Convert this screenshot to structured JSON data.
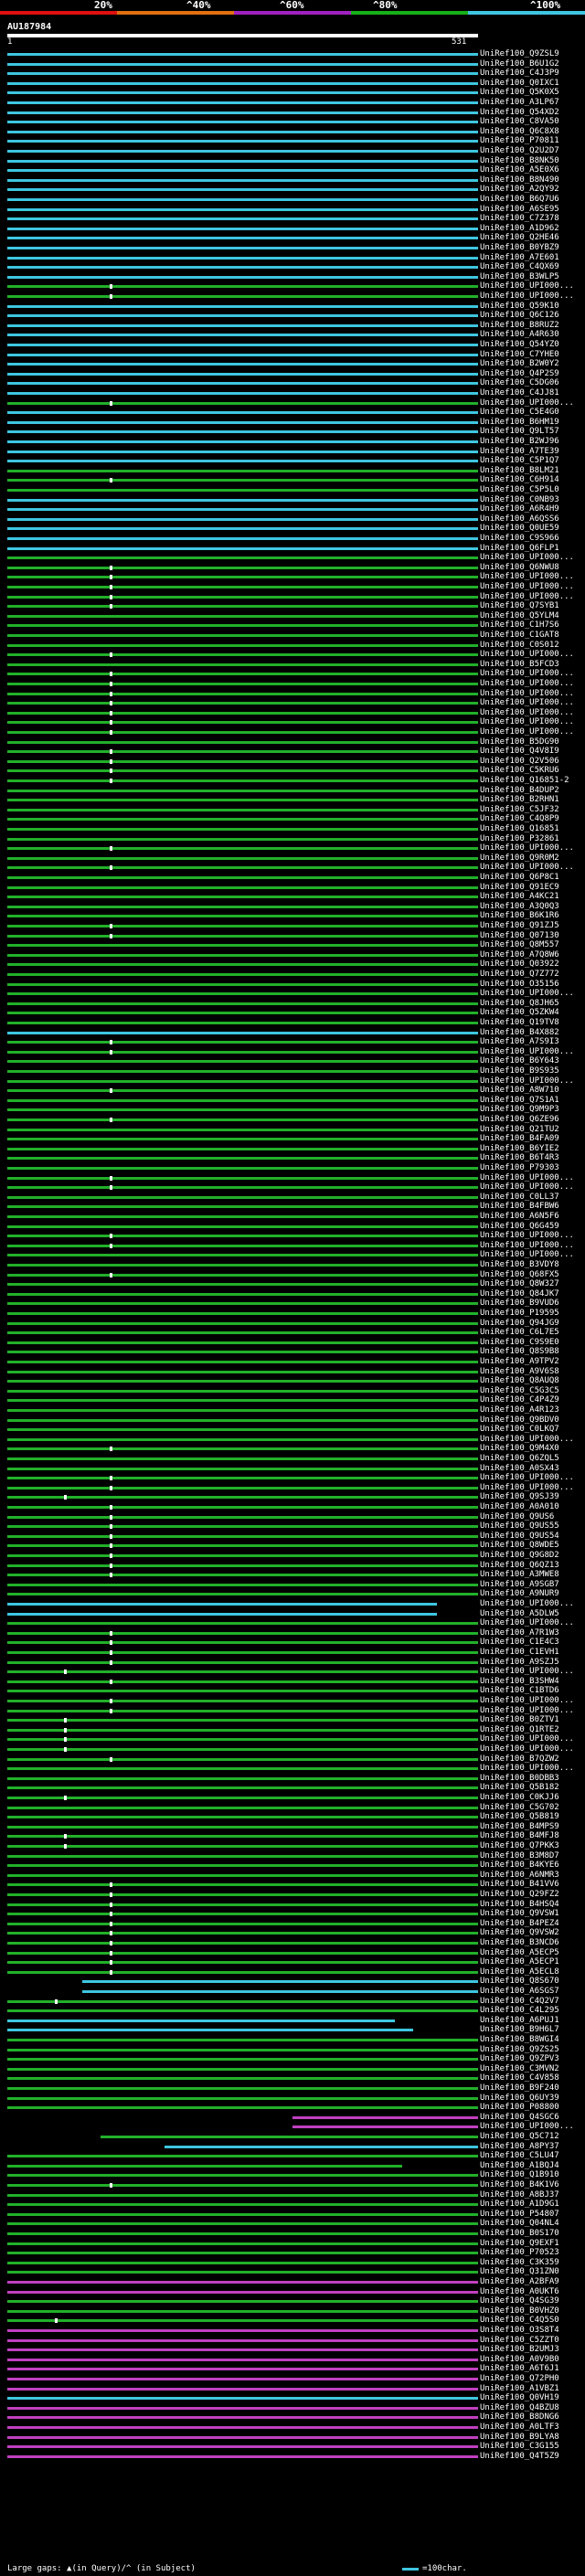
{
  "legend": {
    "ticks": [
      "20%",
      "^40%",
      "^60%",
      "^80%",
      "^100%"
    ],
    "colors": [
      "#e01010",
      "#e07010",
      "#a020c0",
      "#18b018",
      "#3ec6e0"
    ]
  },
  "query": {
    "name": "AU187984",
    "start": "1",
    "end": "531"
  },
  "hits": [
    {
      "label": "UniRef100_Q9ZSL9",
      "color": "cyan"
    },
    {
      "label": "UniRef100_B6U1G2",
      "color": "cyan"
    },
    {
      "label": "UniRef100_C4J3P9",
      "color": "cyan"
    },
    {
      "label": "UniRef100_Q0IXC1",
      "color": "cyan"
    },
    {
      "label": "UniRef100_Q5K0X5",
      "color": "cyan"
    },
    {
      "label": "UniRef100_A3LP67",
      "color": "cyan"
    },
    {
      "label": "UniRef100_Q54XD2",
      "color": "cyan"
    },
    {
      "label": "UniRef100_C8VA50",
      "color": "cyan"
    },
    {
      "label": "UniRef100_Q6C8X8",
      "color": "cyan"
    },
    {
      "label": "UniRef100_P70811",
      "color": "cyan"
    },
    {
      "label": "UniRef100_Q2U2D7",
      "color": "cyan"
    },
    {
      "label": "UniRef100_B8NK50",
      "color": "cyan"
    },
    {
      "label": "UniRef100_A5E0X6",
      "color": "cyan"
    },
    {
      "label": "UniRef100_B8N490",
      "color": "cyan"
    },
    {
      "label": "UniRef100_A2QY92",
      "color": "cyan"
    },
    {
      "label": "UniRef100_B6Q7U6",
      "color": "cyan"
    },
    {
      "label": "UniRef100_A6SE95",
      "color": "cyan"
    },
    {
      "label": "UniRef100_C7Z378",
      "color": "cyan"
    },
    {
      "label": "UniRef100_A1D962",
      "color": "cyan"
    },
    {
      "label": "UniRef100_Q2HE46",
      "color": "cyan"
    },
    {
      "label": "UniRef100_B0YBZ9",
      "color": "cyan"
    },
    {
      "label": "UniRef100_A7E601",
      "color": "cyan"
    },
    {
      "label": "UniRef100_C4QX69",
      "color": "cyan"
    },
    {
      "label": "UniRef100_B3WLP5",
      "color": "cyan"
    },
    {
      "label": "UniRef100_UPI000...",
      "color": "green",
      "dot": 120
    },
    {
      "label": "UniRef100_UPI000...",
      "color": "green",
      "dot": 120
    },
    {
      "label": "UniRef100_Q59K10",
      "color": "cyan"
    },
    {
      "label": "UniRef100_Q6C126",
      "color": "cyan"
    },
    {
      "label": "UniRef100_B8RUZ2",
      "color": "cyan"
    },
    {
      "label": "UniRef100_A4R630",
      "color": "cyan"
    },
    {
      "label": "UniRef100_Q54YZ0",
      "color": "cyan"
    },
    {
      "label": "UniRef100_C7YHE0",
      "color": "cyan"
    },
    {
      "label": "UniRef100_B2W0Y2",
      "color": "cyan"
    },
    {
      "label": "UniRef100_Q4P2S9",
      "color": "cyan"
    },
    {
      "label": "UniRef100_C5DG06",
      "color": "cyan"
    },
    {
      "label": "UniRef100_C4JJ81",
      "color": "cyan"
    },
    {
      "label": "UniRef100_UPI000...",
      "color": "green",
      "dot": 120
    },
    {
      "label": "UniRef100_C5E4G0",
      "color": "cyan"
    },
    {
      "label": "UniRef100_B6HM19",
      "color": "cyan"
    },
    {
      "label": "UniRef100_Q9LT57",
      "color": "cyan"
    },
    {
      "label": "UniRef100_B2WJ96",
      "color": "cyan"
    },
    {
      "label": "UniRef100_A7TE39",
      "color": "cyan"
    },
    {
      "label": "UniRef100_C5P1Q7",
      "color": "cyan"
    },
    {
      "label": "UniRef100_B8LM21",
      "color": "green"
    },
    {
      "label": "UniRef100_C6H914",
      "color": "green",
      "dot": 120
    },
    {
      "label": "UniRef100_C5P5L0",
      "color": "green"
    },
    {
      "label": "UniRef100_C0NB93",
      "color": "cyan"
    },
    {
      "label": "UniRef100_A6R4H9",
      "color": "cyan"
    },
    {
      "label": "UniRef100_A6QSS6",
      "color": "cyan"
    },
    {
      "label": "UniRef100_Q0UE59",
      "color": "cyan"
    },
    {
      "label": "UniRef100_C9S966",
      "color": "cyan"
    },
    {
      "label": "UniRef100_Q6FLP1",
      "color": "cyan"
    },
    {
      "label": "UniRef100_UPI000...",
      "color": "green"
    },
    {
      "label": "UniRef100_Q6NWU8",
      "color": "green",
      "dot": 120
    },
    {
      "label": "UniRef100_UPI000...",
      "color": "green",
      "dot": 120
    },
    {
      "label": "UniRef100_UPI000...",
      "color": "green",
      "dot": 120
    },
    {
      "label": "UniRef100_UPI000...",
      "color": "green",
      "dot": 120
    },
    {
      "label": "UniRef100_Q7SYB1",
      "color": "green",
      "dot": 120
    },
    {
      "label": "UniRef100_Q5YLM4",
      "color": "green"
    },
    {
      "label": "UniRef100_C1H7S6",
      "color": "green"
    },
    {
      "label": "UniRef100_C1GAT8",
      "color": "green"
    },
    {
      "label": "UniRef100_C0S012",
      "color": "green"
    },
    {
      "label": "UniRef100_UPI000...",
      "color": "green",
      "dot": 120
    },
    {
      "label": "UniRef100_B5FCD3",
      "color": "green"
    },
    {
      "label": "UniRef100_UPI000...",
      "color": "green",
      "dot": 120
    },
    {
      "label": "UniRef100_UPI000...",
      "color": "green",
      "dot": 120
    },
    {
      "label": "UniRef100_UPI000...",
      "color": "green",
      "dot": 120
    },
    {
      "label": "UniRef100_UPI000...",
      "color": "green",
      "dot": 120
    },
    {
      "label": "UniRef100_UPI000...",
      "color": "green",
      "dot": 120
    },
    {
      "label": "UniRef100_UPI000...",
      "color": "green",
      "dot": 120
    },
    {
      "label": "UniRef100_UPI000...",
      "color": "green",
      "dot": 120
    },
    {
      "label": "UniRef100_B5DG90",
      "color": "green"
    },
    {
      "label": "UniRef100_Q4V8I9",
      "color": "green",
      "dot": 120
    },
    {
      "label": "UniRef100_Q2V506",
      "color": "green",
      "dot": 120
    },
    {
      "label": "UniRef100_C5KRU6",
      "color": "green",
      "dot": 120
    },
    {
      "label": "UniRef100_Q16851-2",
      "color": "green",
      "dot": 120
    },
    {
      "label": "UniRef100_B4DUP2",
      "color": "green"
    },
    {
      "label": "UniRef100_B2RHN1",
      "color": "green"
    },
    {
      "label": "UniRef100_C5JF32",
      "color": "green"
    },
    {
      "label": "UniRef100_C4Q8P9",
      "color": "green"
    },
    {
      "label": "UniRef100_Q16851",
      "color": "green"
    },
    {
      "label": "UniRef100_P32861",
      "color": "green"
    },
    {
      "label": "UniRef100_UPI000...",
      "color": "green",
      "dot": 120
    },
    {
      "label": "UniRef100_Q9R0M2",
      "color": "green"
    },
    {
      "label": "UniRef100_UPI000...",
      "color": "green",
      "dot": 120
    },
    {
      "label": "UniRef100_Q6P8C1",
      "color": "green"
    },
    {
      "label": "UniRef100_Q91EC9",
      "color": "green"
    },
    {
      "label": "UniRef100_A4KC21",
      "color": "green"
    },
    {
      "label": "UniRef100_A3Q0Q3",
      "color": "green"
    },
    {
      "label": "UniRef100_B6K1R6",
      "color": "green"
    },
    {
      "label": "UniRef100_Q91ZJ5",
      "color": "green",
      "dot": 120
    },
    {
      "label": "UniRef100_Q07130",
      "color": "green",
      "dot": 120
    },
    {
      "label": "UniRef100_Q8M557",
      "color": "green"
    },
    {
      "label": "UniRef100_A7Q8W6",
      "color": "green"
    },
    {
      "label": "UniRef100_Q03922",
      "color": "green"
    },
    {
      "label": "UniRef100_Q7Z772",
      "color": "green"
    },
    {
      "label": "UniRef100_O35156",
      "color": "green"
    },
    {
      "label": "UniRef100_UPI000...",
      "color": "green"
    },
    {
      "label": "UniRef100_Q8JH65",
      "color": "green"
    },
    {
      "label": "UniRef100_Q5ZKW4",
      "color": "green"
    },
    {
      "label": "UniRef100_Q19TV8",
      "color": "green"
    },
    {
      "label": "UniRef100_B4X882",
      "color": "cyan"
    },
    {
      "label": "UniRef100_A7S9I3",
      "color": "green",
      "dot": 120
    },
    {
      "label": "UniRef100_UPI000...",
      "color": "green",
      "dot": 120
    },
    {
      "label": "UniRef100_B6Y643",
      "color": "green"
    },
    {
      "label": "UniRef100_B9S935",
      "color": "green"
    },
    {
      "label": "UniRef100_UPI000...",
      "color": "green"
    },
    {
      "label": "UniRef100_A8W710",
      "color": "green",
      "dot": 120
    },
    {
      "label": "UniRef100_Q7S1A1",
      "color": "green"
    },
    {
      "label": "UniRef100_Q9M9P3",
      "color": "green"
    },
    {
      "label": "UniRef100_Q6ZE96",
      "color": "green",
      "dot": 120
    },
    {
      "label": "UniRef100_Q21TU2",
      "color": "green"
    },
    {
      "label": "UniRef100_B4FA09",
      "color": "green"
    },
    {
      "label": "UniRef100_B6YIE2",
      "color": "green"
    },
    {
      "label": "UniRef100_B6T4R3",
      "color": "green"
    },
    {
      "label": "UniRef100_P79303",
      "color": "green"
    },
    {
      "label": "UniRef100_UPI000...",
      "color": "green",
      "dot": 120
    },
    {
      "label": "UniRef100_UPI000...",
      "color": "green",
      "dot": 120
    },
    {
      "label": "UniRef100_C0LL37",
      "color": "green"
    },
    {
      "label": "UniRef100_B4FBW6",
      "color": "green"
    },
    {
      "label": "UniRef100_A6N5F6",
      "color": "green"
    },
    {
      "label": "UniRef100_Q6G459",
      "color": "green"
    },
    {
      "label": "UniRef100_UPI000...",
      "color": "green",
      "dot": 120
    },
    {
      "label": "UniRef100_UPI000...",
      "color": "green",
      "dot": 120
    },
    {
      "label": "UniRef100_UPI000...",
      "color": "green"
    },
    {
      "label": "UniRef100_B3VDY8",
      "color": "green"
    },
    {
      "label": "UniRef100_Q68FX5",
      "color": "green",
      "dot": 120
    },
    {
      "label": "UniRef100_Q8W327",
      "color": "green"
    },
    {
      "label": "UniRef100_Q84JK7",
      "color": "green"
    },
    {
      "label": "UniRef100_B9VUD6",
      "color": "green"
    },
    {
      "label": "UniRef100_P19595",
      "color": "green"
    },
    {
      "label": "UniRef100_Q94JG9",
      "color": "green"
    },
    {
      "label": "UniRef100_C6L7E5",
      "color": "green"
    },
    {
      "label": "UniRef100_C9S9E0",
      "color": "green"
    },
    {
      "label": "UniRef100_Q8S9B8",
      "color": "green"
    },
    {
      "label": "UniRef100_A9TPV2",
      "color": "green"
    },
    {
      "label": "UniRef100_A9V6S8",
      "color": "green"
    },
    {
      "label": "UniRef100_Q8AUQ8",
      "color": "green"
    },
    {
      "label": "UniRef100_C5G3C5",
      "color": "green"
    },
    {
      "label": "UniRef100_C4P4Z9",
      "color": "green"
    },
    {
      "label": "UniRef100_A4R123",
      "color": "green"
    },
    {
      "label": "UniRef100_Q9BDV0",
      "color": "green"
    },
    {
      "label": "UniRef100_C0LKQ7",
      "color": "green"
    },
    {
      "label": "UniRef100_UPI000...",
      "color": "green"
    },
    {
      "label": "UniRef100_Q9M4X0",
      "color": "green",
      "dot": 120
    },
    {
      "label": "UniRef100_Q6ZQL5",
      "color": "green"
    },
    {
      "label": "UniRef100_A0SX43",
      "color": "green"
    },
    {
      "label": "UniRef100_UPI000...",
      "color": "green",
      "dot": 120
    },
    {
      "label": "UniRef100_UPI000...",
      "color": "green",
      "dot": 120
    },
    {
      "label": "UniRef100_Q9SJ39",
      "color": "green",
      "dot": 70
    },
    {
      "label": "UniRef100_A0A010",
      "color": "green",
      "dot": 120
    },
    {
      "label": "UniRef100_Q9US6",
      "color": "green",
      "dot": 120
    },
    {
      "label": "UniRef100_Q9US55",
      "color": "green",
      "dot": 120
    },
    {
      "label": "UniRef100_Q9US54",
      "color": "green",
      "dot": 120
    },
    {
      "label": "UniRef100_Q8WDE5",
      "color": "green",
      "dot": 120
    },
    {
      "label": "UniRef100_Q9G8D2",
      "color": "green",
      "dot": 120
    },
    {
      "label": "UniRef100_Q6QZ13",
      "color": "green",
      "dot": 120
    },
    {
      "label": "UniRef100_A3MWE8",
      "color": "green",
      "dot": 120
    },
    {
      "label": "UniRef100_A9SGB7",
      "color": "green"
    },
    {
      "label": "UniRef100_A9NUR9",
      "color": "green"
    },
    {
      "label": "UniRef100_UPI000...",
      "color": "cyan",
      "span": 478
    },
    {
      "label": "UniRef100_A5DLW5",
      "color": "cyan",
      "span": 478
    },
    {
      "label": "UniRef100_UPI000...",
      "color": "green"
    },
    {
      "label": "UniRef100_A7R1W3",
      "color": "green",
      "dot": 120
    },
    {
      "label": "UniRef100_C1E4C3",
      "color": "green",
      "dot": 120
    },
    {
      "label": "UniRef100_C1EVH1",
      "color": "green",
      "dot": 120
    },
    {
      "label": "UniRef100_A9SZJ5",
      "color": "green",
      "dot": 120
    },
    {
      "label": "UniRef100_UPI000...",
      "color": "green",
      "dot": 70
    },
    {
      "label": "UniRef100_B3SHW4",
      "color": "green",
      "dot": 120
    },
    {
      "label": "UniRef100_C1BTD6",
      "color": "green"
    },
    {
      "label": "UniRef100_UPI000...",
      "color": "green",
      "dot": 120
    },
    {
      "label": "UniRef100_UPI000...",
      "color": "green",
      "dot": 120
    },
    {
      "label": "UniRef100_B0ZTV1",
      "color": "green",
      "dot": 70
    },
    {
      "label": "UniRef100_Q1RTE2",
      "color": "green",
      "dot": 70
    },
    {
      "label": "UniRef100_UPI000...",
      "color": "green",
      "dot": 70
    },
    {
      "label": "UniRef100_UPI000...",
      "color": "green",
      "dot": 70
    },
    {
      "label": "UniRef100_B7QZW2",
      "color": "green",
      "dot": 120
    },
    {
      "label": "UniRef100_UPI000...",
      "color": "green"
    },
    {
      "label": "UniRef100_B0DBB3",
      "color": "green"
    },
    {
      "label": "UniRef100_Q5B182",
      "color": "green"
    },
    {
      "label": "UniRef100_C0KJJ6",
      "color": "green",
      "dot": 70
    },
    {
      "label": "UniRef100_C5G702",
      "color": "green"
    },
    {
      "label": "UniRef100_Q5B819",
      "color": "green"
    },
    {
      "label": "UniRef100_B4MPS9",
      "color": "green"
    },
    {
      "label": "UniRef100_B4MFJ8",
      "color": "green",
      "dot": 70
    },
    {
      "label": "UniRef100_Q7PKK3",
      "color": "green",
      "dot": 70
    },
    {
      "label": "UniRef100_B3M8D7",
      "color": "green"
    },
    {
      "label": "UniRef100_B4KYE6",
      "color": "green"
    },
    {
      "label": "UniRef100_A6NMR3",
      "color": "green"
    },
    {
      "label": "UniRef100_B41VV6",
      "color": "green",
      "dot": 120
    },
    {
      "label": "UniRef100_Q29FZ2",
      "color": "green",
      "dot": 120
    },
    {
      "label": "UniRef100_B4HSQ4",
      "color": "green",
      "dot": 120
    },
    {
      "label": "UniRef100_Q9VSW1",
      "color": "green",
      "dot": 120
    },
    {
      "label": "UniRef100_B4PEZ4",
      "color": "green",
      "dot": 120
    },
    {
      "label": "UniRef100_Q9VSW2",
      "color": "green",
      "dot": 120
    },
    {
      "label": "UniRef100_B3NCD6",
      "color": "green",
      "dot": 120
    },
    {
      "label": "UniRef100_A5ECP5",
      "color": "green",
      "dot": 120
    },
    {
      "label": "UniRef100_A5ECP1",
      "color": "green",
      "dot": 120
    },
    {
      "label": "UniRef100_A5ECL8",
      "color": "green",
      "dot": 120
    },
    {
      "label": "UniRef100_Q8S670",
      "color": "cyan",
      "from": 90
    },
    {
      "label": "UniRef100_A6SGS7",
      "color": "cyan",
      "from": 90
    },
    {
      "label": "UniRef100_C4Q2V7",
      "color": "green",
      "dot": 60
    },
    {
      "label": "UniRef100_C4L295",
      "color": "green"
    },
    {
      "label": "UniRef100_A6PUJ1",
      "color": "cyan",
      "span": 432
    },
    {
      "label": "UniRef100_B9H6L7",
      "color": "cyan",
      "span": 452
    },
    {
      "label": "UniRef100_B8WGI4",
      "color": "green"
    },
    {
      "label": "UniRef100_Q9ZS25",
      "color": "green"
    },
    {
      "label": "UniRef100_Q9ZPV3",
      "color": "green"
    },
    {
      "label": "UniRef100_C3MVN2",
      "color": "green"
    },
    {
      "label": "UniRef100_C4V858",
      "color": "green"
    },
    {
      "label": "UniRef100_B9F240",
      "color": "green"
    },
    {
      "label": "UniRef100_Q6UY39",
      "color": "green"
    },
    {
      "label": "UniRef100_P08800",
      "color": "green"
    },
    {
      "label": "UniRef100_Q4SGC6",
      "color": "magenta",
      "from": 320
    },
    {
      "label": "UniRef100_UPI000...",
      "color": "magenta",
      "from": 320
    },
    {
      "label": "UniRef100_Q5C712",
      "color": "green",
      "from": 110
    },
    {
      "label": "UniRef100_A8PY37",
      "color": "cyan",
      "from": 180
    },
    {
      "label": "UniRef100_C5LU47",
      "color": "green"
    },
    {
      "label": "UniRef100_A1BQJ4",
      "color": "green",
      "span": 440
    },
    {
      "label": "UniRef100_Q1B910",
      "color": "green"
    },
    {
      "label": "UniRef100_B4K1V6",
      "color": "green",
      "dot": 120
    },
    {
      "label": "UniRef100_A8BJ37",
      "color": "green"
    },
    {
      "label": "UniRef100_A1D9G1",
      "color": "green"
    },
    {
      "label": "UniRef100_P54807",
      "color": "green"
    },
    {
      "label": "UniRef100_Q04NL4",
      "color": "green"
    },
    {
      "label": "UniRef100_B0S170",
      "color": "green"
    },
    {
      "label": "UniRef100_Q9EXF1",
      "color": "green"
    },
    {
      "label": "UniRef100_P70523",
      "color": "green"
    },
    {
      "label": "UniRef100_C3K359",
      "color": "green"
    },
    {
      "label": "UniRef100_Q31ZN0",
      "color": "green"
    },
    {
      "label": "UniRef100_A2BFA9",
      "color": "magenta"
    },
    {
      "label": "UniRef100_A0UKT6",
      "color": "magenta"
    },
    {
      "label": "UniRef100_Q4SG39",
      "color": "green"
    },
    {
      "label": "UniRef100_B0VHZ0",
      "color": "green"
    },
    {
      "label": "UniRef100_C4Q5S0",
      "color": "green",
      "dot": 60
    },
    {
      "label": "UniRef100_O3S8T4",
      "color": "magenta"
    },
    {
      "label": "UniRef100_C5ZZT0",
      "color": "magenta"
    },
    {
      "label": "UniRef100_B2UMJ3",
      "color": "magenta"
    },
    {
      "label": "UniRef100_A0V9B0",
      "color": "magenta"
    },
    {
      "label": "UniRef100_A6T6J1",
      "color": "magenta"
    },
    {
      "label": "UniRef100_Q72PH0",
      "color": "magenta"
    },
    {
      "label": "UniRef100_A1VBZ1",
      "color": "magenta"
    },
    {
      "label": "UniRef100_Q0VH19",
      "color": "cyan"
    },
    {
      "label": "UniRef100_Q4BZU8",
      "color": "magenta"
    },
    {
      "label": "UniRef100_B8DNG6",
      "color": "magenta"
    },
    {
      "label": "UniRef100_A0LTF3",
      "color": "magenta"
    },
    {
      "label": "UniRef100_B9LYA8",
      "color": "magenta"
    },
    {
      "label": "UniRef100_C3G155",
      "color": "magenta"
    },
    {
      "label": "UniRef100_Q4T5Z9",
      "color": "magenta"
    }
  ],
  "footer": {
    "gap_note": "Large gaps: ▲(in Query)/^ (in Subject)",
    "scale_label": "=100char."
  }
}
